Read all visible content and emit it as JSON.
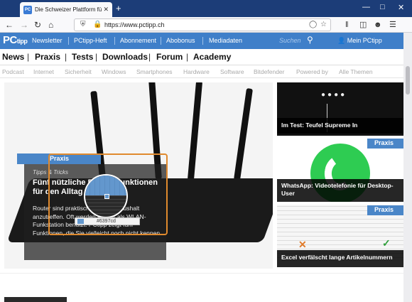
{
  "browser": {
    "tab_title": "Die Schweizer Plattform für Co",
    "tab_favicon": "PC",
    "url": "https://www.pctipp.ch",
    "new_tab": "+",
    "close_tab": "✕"
  },
  "header": {
    "logo": "PC",
    "logo_sub": "tipp",
    "links": [
      "Newsletter",
      "PCtipp-Heft",
      "Abonnement",
      "Abobonus",
      "Mediadaten"
    ],
    "search_placeholder": "Suchen",
    "account": "Mein PCtipp",
    "accent": "#3f7fc9"
  },
  "main_nav": [
    "News",
    "Praxis",
    "Tests",
    "Downloads",
    "Forum",
    "Academy"
  ],
  "main_nav_sep": "|",
  "sub_nav": [
    "Podcast",
    "Internet",
    "Sicherheit",
    "Windows",
    "Smartphones",
    "Hardware",
    "Software",
    "Bitdefender",
    "Powered by",
    "Alle Themen"
  ],
  "hero": {
    "badge": "Praxis",
    "kicker": "Tipps & Tricks",
    "headline": "Fünf nützliche Router-Funktionen für den Alltag",
    "teaser": "Router sind praktisch in jedem Haushalt anzutreffen. Oft werden sie nur als WLAN-Funkstation benutzt. PCtipp zeigt fünf Funktionen, die Sie vielleicht noch nicht kennen."
  },
  "color_picker": {
    "hex": "#6397cd"
  },
  "cards": [
    {
      "title": "Im Test: Teufel Supreme In",
      "badge": ""
    },
    {
      "title": "WhatsApp: Videotelefonie für Desktop-User",
      "badge": "Praxis"
    },
    {
      "title": "Excel verfälscht lange Artikelnummern",
      "badge": "Praxis"
    }
  ]
}
